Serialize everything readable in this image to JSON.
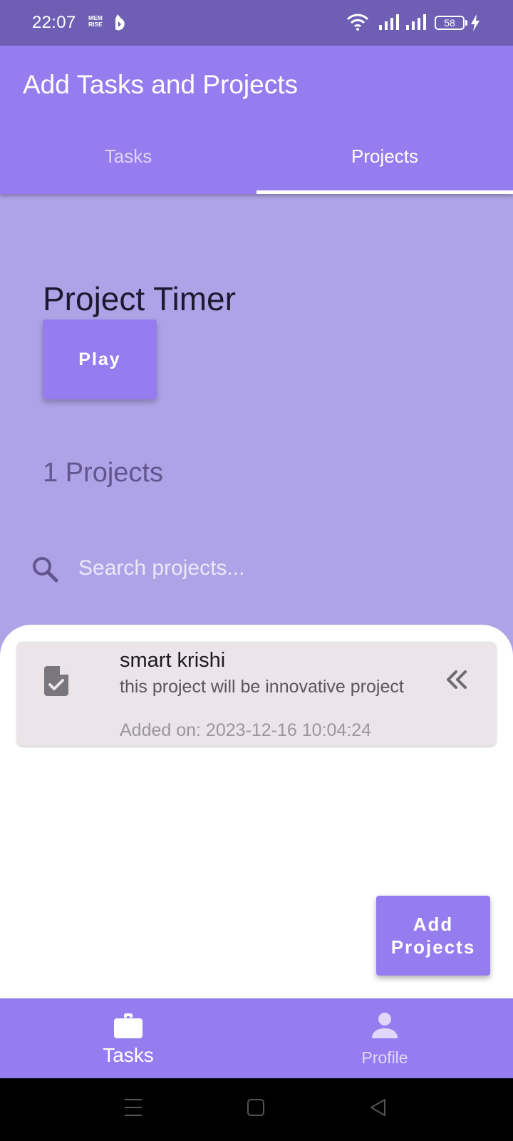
{
  "status_bar": {
    "time": "22:07",
    "app_logo_text": "MEM RISE",
    "battery_level": "58"
  },
  "app_bar": {
    "title": "Add Tasks and Projects",
    "tabs": [
      {
        "label": "Tasks",
        "selected": false
      },
      {
        "label": "Projects",
        "selected": true
      }
    ]
  },
  "timer": {
    "title": "Project Timer",
    "play_label": "Play"
  },
  "projects": {
    "count_text": "1 Projects",
    "search_placeholder": "Search projects...",
    "items": [
      {
        "name": "smart krishi",
        "description": "this project will be innovative project",
        "added_on": "Added on: 2023-12-16 10:04:24"
      }
    ]
  },
  "fab": {
    "label": "Add Projects"
  },
  "bottom_nav": {
    "items": [
      {
        "label": "Tasks",
        "icon": "briefcase-icon",
        "selected": true
      },
      {
        "label": "Profile",
        "icon": "person-icon",
        "selected": false
      }
    ]
  },
  "colors": {
    "primary": "#957def",
    "status_bar": "#6e5fb4",
    "background": "#afa3e7",
    "card": "#ebe4e8"
  }
}
